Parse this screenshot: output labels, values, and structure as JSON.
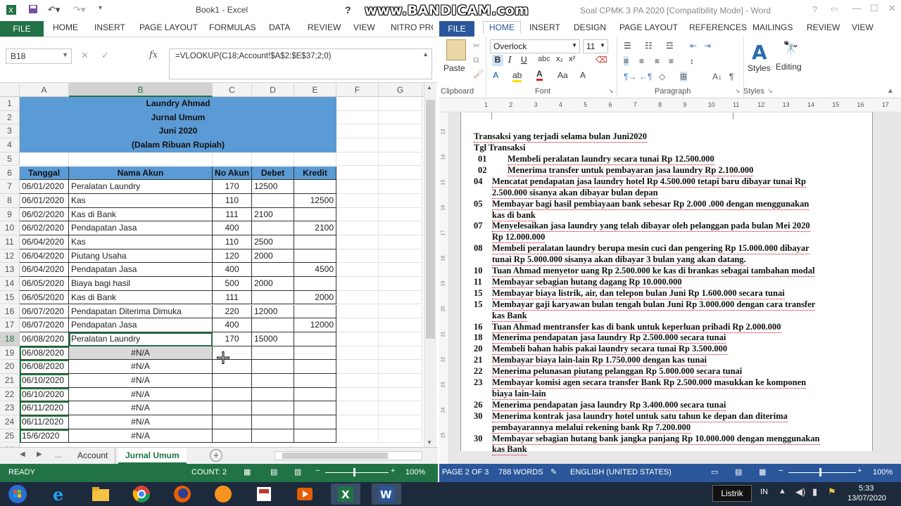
{
  "watermark": "www.BANDICAM.com",
  "excel": {
    "title": "Book1 - Excel",
    "file_tab": "FILE",
    "tabs": [
      "HOME",
      "INSERT",
      "PAGE LAYOUT",
      "FORMULAS",
      "DATA",
      "REVIEW",
      "VIEW",
      "NITRO PRO"
    ],
    "name_box": "B18",
    "fx": "fx",
    "formula": "=VLOOKUP(C18;Account!$A$2:$E$37;2;0)",
    "columns": [
      "A",
      "B",
      "C",
      "D",
      "E",
      "F",
      "G"
    ],
    "selected_column": "B",
    "header_block": [
      "Laundry Ahmad",
      "Jurnal Umum",
      "Juni 2020",
      "(Dalam Ribuan Rupiah)"
    ],
    "table_headers": [
      "Tanggal",
      "Nama Akun",
      "No Akun",
      "Debet",
      "Kredit"
    ],
    "rows": [
      {
        "n": "7",
        "tgl": "06/01/2020",
        "akun": "Peralatan Laundry",
        "no": "170",
        "debet": "12500",
        "kredit": ""
      },
      {
        "n": "8",
        "tgl": "06/01/2020",
        "akun": "Kas",
        "no": "110",
        "debet": "",
        "kredit": "12500"
      },
      {
        "n": "9",
        "tgl": "06/02/2020",
        "akun": "Kas di Bank",
        "no": "111",
        "debet": "2100",
        "kredit": ""
      },
      {
        "n": "10",
        "tgl": "06/02/2020",
        "akun": "Pendapatan Jasa",
        "no": "400",
        "debet": "",
        "kredit": "2100"
      },
      {
        "n": "11",
        "tgl": "06/04/2020",
        "akun": "Kas",
        "no": "110",
        "debet": "2500",
        "kredit": ""
      },
      {
        "n": "12",
        "tgl": "06/04/2020",
        "akun": "Piutang Usaha",
        "no": "120",
        "debet": "2000",
        "kredit": ""
      },
      {
        "n": "13",
        "tgl": "06/04/2020",
        "akun": "Pendapatan Jasa",
        "no": "400",
        "debet": "",
        "kredit": "4500"
      },
      {
        "n": "14",
        "tgl": "06/05/2020",
        "akun": "Biaya bagi hasil",
        "no": "500",
        "debet": "2000",
        "kredit": ""
      },
      {
        "n": "15",
        "tgl": "06/05/2020",
        "akun": "Kas di Bank",
        "no": "111",
        "debet": "",
        "kredit": "2000"
      },
      {
        "n": "16",
        "tgl": "06/07/2020",
        "akun": "Pendapatan Diterima Dimuka",
        "no": "220",
        "debet": "12000",
        "kredit": ""
      },
      {
        "n": "17",
        "tgl": "06/07/2020",
        "akun": "Pendapatan Jasa",
        "no": "400",
        "debet": "",
        "kredit": "12000"
      },
      {
        "n": "18",
        "tgl": "06/08/2020",
        "akun": "Peralatan Laundry",
        "no": "170",
        "debet": "15000",
        "kredit": ""
      },
      {
        "n": "19",
        "tgl": "06/08/2020",
        "akun": "#N/A",
        "no": "",
        "debet": "",
        "kredit": ""
      },
      {
        "n": "20",
        "tgl": "06/08/2020",
        "akun": "#N/A",
        "no": "",
        "debet": "",
        "kredit": ""
      },
      {
        "n": "21",
        "tgl": "06/10/2020",
        "akun": "#N/A",
        "no": "",
        "debet": "",
        "kredit": ""
      },
      {
        "n": "22",
        "tgl": "06/10/2020",
        "akun": "#N/A",
        "no": "",
        "debet": "",
        "kredit": ""
      },
      {
        "n": "23",
        "tgl": "06/11/2020",
        "akun": "#N/A",
        "no": "",
        "debet": "",
        "kredit": ""
      },
      {
        "n": "24",
        "tgl": "06/11/2020",
        "akun": "#N/A",
        "no": "",
        "debet": "",
        "kredit": ""
      },
      {
        "n": "25",
        "tgl": "15/6/2020",
        "akun": "#N/A",
        "no": "",
        "debet": "",
        "kredit": ""
      }
    ],
    "sheets": [
      "Account",
      "Jurnal Umum"
    ],
    "active_sheet": "Jurnal Umum",
    "sheet_ellipsis": "...",
    "status_ready": "READY",
    "status_count": "COUNT: 2",
    "zoom": "100%"
  },
  "word": {
    "title": "Soal CPMK 3 PA 2020 [Compatibility Mode] - Word",
    "file_tab": "FILE",
    "tabs": [
      "HOME",
      "INSERT",
      "DESIGN",
      "PAGE LAYOUT",
      "REFERENCES",
      "MAILINGS",
      "REVIEW",
      "VIEW"
    ],
    "font_name": "Overlock",
    "font_size": "11",
    "paste_label": "Paste",
    "styles_label": "Styles",
    "editing_label": "Editing",
    "groups": [
      "Clipboard",
      "Font",
      "Paragraph",
      "Styles"
    ],
    "ruler": [
      "1",
      "2",
      "3",
      "4",
      "5",
      "6",
      "7",
      "8",
      "9",
      "10",
      "11",
      "12",
      "13",
      "14",
      "15",
      "16",
      "17"
    ],
    "heading": "Transaksi yang terjadi selama bulan Juni2020",
    "col_header": "Tgl  Transaksi",
    "lines": [
      {
        "num": "01",
        "text": "Membeli peralatan laundry secara tunai Rp 12.500.000",
        "indent": true
      },
      {
        "num": "02",
        "text": "Menerima transfer untuk pembayaran jasa laundry Rp 2.100.000",
        "indent": true
      },
      {
        "num": "04",
        "text": "Mencatat pendapatan jasa laundry hotel Rp 4.500.000 tetapi baru dibayar tunai Rp"
      },
      {
        "num": "",
        "text": "2.500.000 sisanya akan dibayar bulan depan"
      },
      {
        "num": "05",
        "text": "Membayar bagi hasil pembiayaan bank sebesar Rp 2.000 .000 dengan menggunakan"
      },
      {
        "num": "",
        "text": "kas di bank"
      },
      {
        "num": "07",
        "text": "Menyelesaikan jasa laundry yang telah dibayar oleh pelanggan pada bulan Mei 2020"
      },
      {
        "num": "",
        "text": "Rp 12.000.000"
      },
      {
        "num": "08",
        "text": "Membeli peralatan laundry berupa mesin cuci dan pengering Rp 15.000.000 dibayar"
      },
      {
        "num": "",
        "text": "tunai Rp 5.000.000 sisanya akan dibayar 3 bulan yang akan datang."
      },
      {
        "num": "10",
        "text": "Tuan Ahmad menyetor uang Rp 2.500.000  ke kas di brankas sebagai tambahan modal"
      },
      {
        "num": "11",
        "text": "Membayar sebagian hutang dagang Rp 10.000.000"
      },
      {
        "num": "15",
        "text": "Membayar biaya listrik, air, dan telepon bulan Juni Rp 1.600.000 secara tunai"
      },
      {
        "num": "15",
        "text": "Membayar gaji karyawan bulan tengah bulan Juni Rp 3.000.000 dengan cara transfer"
      },
      {
        "num": "",
        "text": "kas Bank"
      },
      {
        "num": "16",
        "text": "Tuan Ahmad mentransfer kas di bank untuk keperluan pribadi Rp 2.000.000"
      },
      {
        "num": "18",
        "text": "Menerima pendapatan jasa laundry Rp 2.500.000 secara tunai"
      },
      {
        "num": "20",
        "text": "Membeli bahan habis pakai laundry secara tunai Rp 3.500.000"
      },
      {
        "num": "21",
        "text": "Membayar biaya lain-lain Rp 1.750.000 dengan kas tunai"
      },
      {
        "num": "22",
        "text": "Menerima pelunasan piutang pelanggan Rp 5.000.000 secara tunai"
      },
      {
        "num": "23",
        "text": "Membayar komisi agen secara transfer Bank Rp 2.500.000 masukkan ke komponen"
      },
      {
        "num": "",
        "text": "biaya lain-lain"
      },
      {
        "num": "26",
        "text": "Menerima pendapatan jasa laundry Rp 3.400.000 secara tunai"
      },
      {
        "num": "30",
        "text": "Menerima kontrak jasa laundry hotel untuk satu tahun ke depan dan diterima"
      },
      {
        "num": "",
        "text": "pembayarannya melalui rekening bank Rp 7.200.000"
      },
      {
        "num": "30",
        "text": "Membayar sebagian hutang bank jangka panjang Rp 10.000.000 dengan menggunakan"
      },
      {
        "num": "",
        "text": "kas Bank"
      }
    ],
    "status_page": "PAGE 2 OF 3",
    "status_words": "788 WORDS",
    "status_lang": "ENGLISH (UNITED STATES)",
    "zoom": "100%"
  },
  "taskbar": {
    "listrik": "Listrik",
    "lang": "IN",
    "time": "5:33",
    "date": "13/07/2020"
  }
}
